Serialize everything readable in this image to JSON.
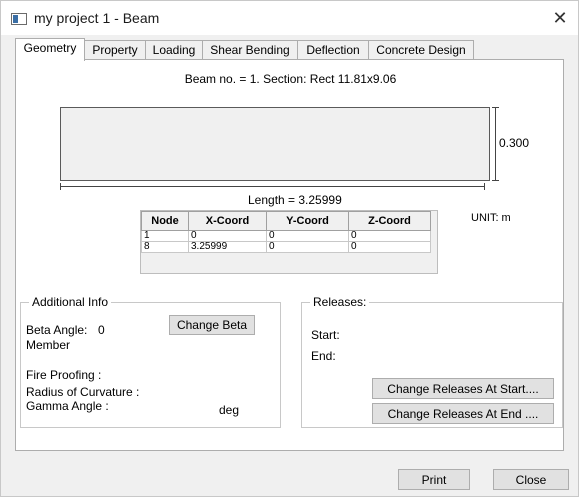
{
  "window": {
    "title": "my project 1 - Beam",
    "close_glyph": "✕"
  },
  "tabs": [
    {
      "label": "Geometry",
      "active": true
    },
    {
      "label": "Property",
      "active": false
    },
    {
      "label": "Loading",
      "active": false
    },
    {
      "label": "Shear Bending",
      "active": false
    },
    {
      "label": "Deflection",
      "active": false
    },
    {
      "label": "Concrete Design",
      "active": false
    }
  ],
  "geometry": {
    "beam_info": "Beam no. = 1. Section: Rect 11.81x9.06",
    "height_label": "0.300",
    "length_label": "Length = 3.25999",
    "unit_label": "UNIT: m",
    "table": {
      "headers": [
        "Node",
        "X-Coord",
        "Y-Coord",
        "Z-Coord"
      ],
      "rows": [
        [
          "1",
          "0",
          "0",
          "0"
        ],
        [
          "8",
          "3.25999",
          "0",
          "0"
        ]
      ]
    }
  },
  "additional_info": {
    "legend": "Additional Info",
    "beta_angle_label": "Beta Angle:",
    "beta_angle_value": "0",
    "member_label": "Member",
    "change_beta_button": "Change Beta",
    "fire_proofing_label": "Fire Proofing :",
    "radius_label": "Radius of Curvature :",
    "gamma_label": "Gamma Angle :",
    "gamma_unit": "deg"
  },
  "releases": {
    "legend": "Releases:",
    "start_label": "Start:",
    "end_label": "End:",
    "change_start_button": "Change Releases At Start....",
    "change_end_button": "Change Releases At End ...."
  },
  "footer": {
    "print_button": "Print",
    "close_button": "Close"
  },
  "colors": {
    "window_bg": "#f0f0f0",
    "panel_bg": "#ffffff",
    "button_bg": "#e1e1e1",
    "border": "#adadad"
  },
  "icons": {
    "app": "window-app-icon",
    "close": "close-icon"
  }
}
